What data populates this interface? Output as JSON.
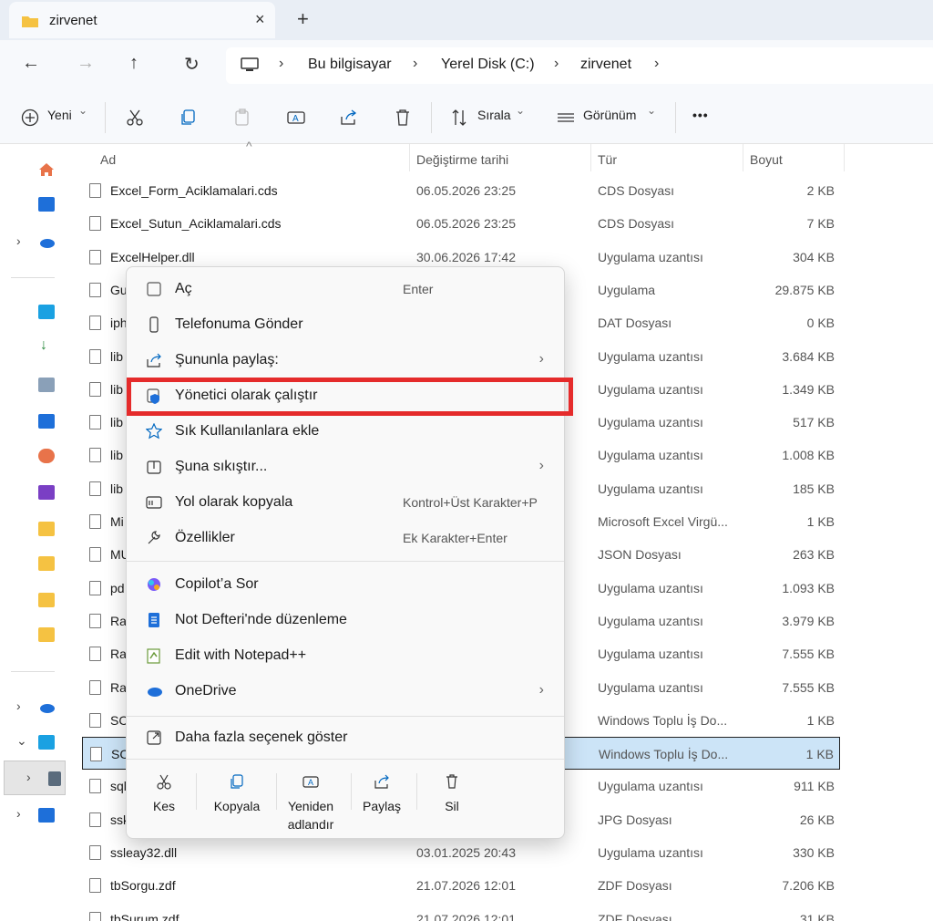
{
  "tab": {
    "title": "zirvenet",
    "close": "×",
    "new": "+"
  },
  "nav": {
    "back": "←",
    "forward": "→",
    "up": "↑",
    "refresh": "↻"
  },
  "breadcrumb": {
    "sep": "›",
    "items": [
      "Bu bilgisayar",
      "Yerel Disk (C:)",
      "zirvenet"
    ]
  },
  "toolbar": {
    "new_label": "Yeni",
    "sort_label": "Sırala",
    "view_label": "Görünüm",
    "more": "•••",
    "dropdown": "⌄"
  },
  "columns": {
    "name": "Ad",
    "date": "Değiştirme tarihi",
    "type": "Tür",
    "size": "Boyut",
    "sort_arrow": "^"
  },
  "files": [
    {
      "name": "Excel_Form_Aciklamalari.cds",
      "date": "06.05.2026 23:25",
      "type": "CDS Dosyası",
      "size": "2 KB"
    },
    {
      "name": "Excel_Sutun_Aciklamalari.cds",
      "date": "06.05.2026 23:25",
      "type": "CDS Dosyası",
      "size": "7 KB"
    },
    {
      "name": "ExcelHelper.dll",
      "date": "30.06.2026 17:42",
      "type": "Uygulama uzantısı",
      "size": "304 KB"
    },
    {
      "name": "Gu",
      "date": "",
      "type": "Uygulama",
      "size": "29.875 KB"
    },
    {
      "name": "iph",
      "date": "",
      "type": "DAT Dosyası",
      "size": "0 KB"
    },
    {
      "name": "lib",
      "date": "",
      "type": "Uygulama uzantısı",
      "size": "3.684 KB"
    },
    {
      "name": "lib",
      "date": "",
      "type": "Uygulama uzantısı",
      "size": "1.349 KB"
    },
    {
      "name": "lib",
      "date": "",
      "type": "Uygulama uzantısı",
      "size": "517 KB"
    },
    {
      "name": "lib",
      "date": "",
      "type": "Uygulama uzantısı",
      "size": "1.008 KB"
    },
    {
      "name": "lib",
      "date": "",
      "type": "Uygulama uzantısı",
      "size": "185 KB"
    },
    {
      "name": "Mi",
      "date": "",
      "type": "Microsoft Excel Virgü...",
      "size": "1 KB"
    },
    {
      "name": "MU",
      "date": "",
      "type": "JSON Dosyası",
      "size": "263 KB"
    },
    {
      "name": "pd",
      "date": "",
      "type": "Uygulama uzantısı",
      "size": "1.093 KB"
    },
    {
      "name": "Ra",
      "date": "",
      "type": "Uygulama uzantısı",
      "size": "3.979 KB"
    },
    {
      "name": "Ra",
      "date": "",
      "type": "Uygulama uzantısı",
      "size": "7.555 KB"
    },
    {
      "name": "Ra",
      "date": "",
      "type": "Uygulama uzantısı",
      "size": "7.555 KB"
    },
    {
      "name": "SC",
      "date": "",
      "type": "Windows Toplu İş Do...",
      "size": "1 KB"
    },
    {
      "name": "SC",
      "date": "",
      "type": "Windows Toplu İş Do...",
      "size": "1 KB"
    },
    {
      "name": "sql",
      "date": "",
      "type": "Uygulama uzantısı",
      "size": "911 KB"
    },
    {
      "name": "ssk",
      "date": "",
      "type": "JPG Dosyası",
      "size": "26 KB"
    },
    {
      "name": "ssleay32.dll",
      "date": "03.01.2025 20:43",
      "type": "Uygulama uzantısı",
      "size": "330 KB"
    },
    {
      "name": "tbSorgu.zdf",
      "date": "21.07.2026 12:01",
      "type": "ZDF Dosyası",
      "size": "7.206 KB"
    },
    {
      "name": "tbSurum.zdf",
      "date": "21.07.2026 12:01",
      "type": "ZDF Dosyası",
      "size": "31 KB"
    }
  ],
  "context_menu": {
    "items": [
      {
        "label": "Aç",
        "key": "Enter",
        "icon": "open-icon"
      },
      {
        "label": "Telefonuma Gönder",
        "key": "",
        "icon": "phone-icon"
      },
      {
        "label": "Şununla paylaş:",
        "key": "",
        "icon": "share-icon",
        "arrow": "›"
      },
      {
        "label": "Yönetici olarak çalıştır",
        "key": "",
        "icon": "shield-icon"
      },
      {
        "label": "Sık Kullanılanlara ekle",
        "key": "",
        "icon": "star-icon"
      },
      {
        "label": "Şuna sıkıştır...",
        "key": "",
        "icon": "zip-icon",
        "arrow": "›"
      },
      {
        "label": "Yol olarak kopyala",
        "key": "Kontrol+Üst Karakter+P",
        "icon": "path-icon"
      },
      {
        "label": "Özellikler",
        "key": "Ek Karakter+Enter",
        "icon": "wrench-icon"
      },
      {
        "label": "Copilot’a Sor",
        "key": "",
        "icon": "copilot-icon"
      },
      {
        "label": "Not Defteri'nde düzenleme",
        "key": "",
        "icon": "notepad-icon"
      },
      {
        "label": "Edit with Notepad++",
        "key": "",
        "icon": "notepadpp-icon"
      },
      {
        "label": "OneDrive",
        "key": "",
        "icon": "onedrive-icon",
        "arrow": "›"
      },
      {
        "label": "Daha fazla seçenek göster",
        "key": "",
        "icon": "more-options-icon"
      }
    ],
    "quick_actions": [
      {
        "label": "Kes",
        "icon": "cut-icon"
      },
      {
        "label": "Kopyala",
        "icon": "copy-icon"
      },
      {
        "label": "Yeniden adlandır",
        "icon": "rename-icon"
      },
      {
        "label": "Paylaş",
        "icon": "share-icon"
      },
      {
        "label": "Sil",
        "icon": "trash-icon"
      }
    ]
  },
  "colors": {
    "highlight": "#e52b2b",
    "selection": "#cce4f7",
    "folder": "#f5c242",
    "accent": "#0067c0"
  }
}
